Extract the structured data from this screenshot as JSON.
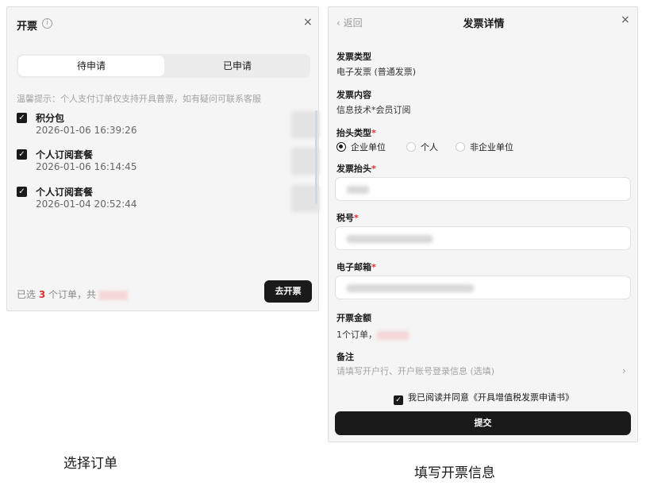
{
  "left_panel": {
    "title": "开票",
    "info_icon": "info-circle-icon",
    "close_icon": "close-icon",
    "tabs": [
      {
        "label": "待申请",
        "active": true
      },
      {
        "label": "已申请",
        "active": false
      }
    ],
    "tip": "温馨提示：个人支付订单仅支持开具普票，如有疑问可联系客服",
    "orders": [
      {
        "name": "积分包",
        "time": "2026-01-06 16:39:26",
        "checked": true
      },
      {
        "name": "个人订阅套餐",
        "time": "2026-01-06 16:14:45",
        "checked": true
      },
      {
        "name": "个人订阅套餐",
        "time": "2026-01-04 20:52:44",
        "checked": true
      }
    ],
    "footer": {
      "prefix": "已选",
      "count": "3",
      "suffix": "个订单，共"
    },
    "submit_label": "去开票",
    "accent_color": "#e03131"
  },
  "right_panel": {
    "back_label": "返回",
    "back_icon": "chevron-left-icon",
    "title": "发票详情",
    "close_icon": "close-icon",
    "invoice_type_label": "发票类型",
    "invoice_type_value": "电子发票 (普通发票)",
    "invoice_content_label": "发票内容",
    "invoice_content_value": "信息技术*会员订阅",
    "header_type_label": "抬头类型",
    "header_type_options": [
      {
        "label": "企业单位",
        "selected": true
      },
      {
        "label": "个人",
        "selected": false
      },
      {
        "label": "非企业单位",
        "selected": false
      }
    ],
    "invoice_header_label": "发票抬头",
    "tax_id_label": "税号",
    "email_label": "电子邮箱",
    "amount_label": "开票金额",
    "amount_prefix": "1个订单，",
    "remark_label": "备注",
    "remark_placeholder": "请填写开户行、开户账号登录信息 (选填)",
    "agree_text": "我已阅读并同意《开具增值税发票申请书》",
    "submit_label": "提交",
    "required_mark": "*"
  },
  "captions": {
    "left": "选择订单",
    "right": "填写开票信息"
  }
}
